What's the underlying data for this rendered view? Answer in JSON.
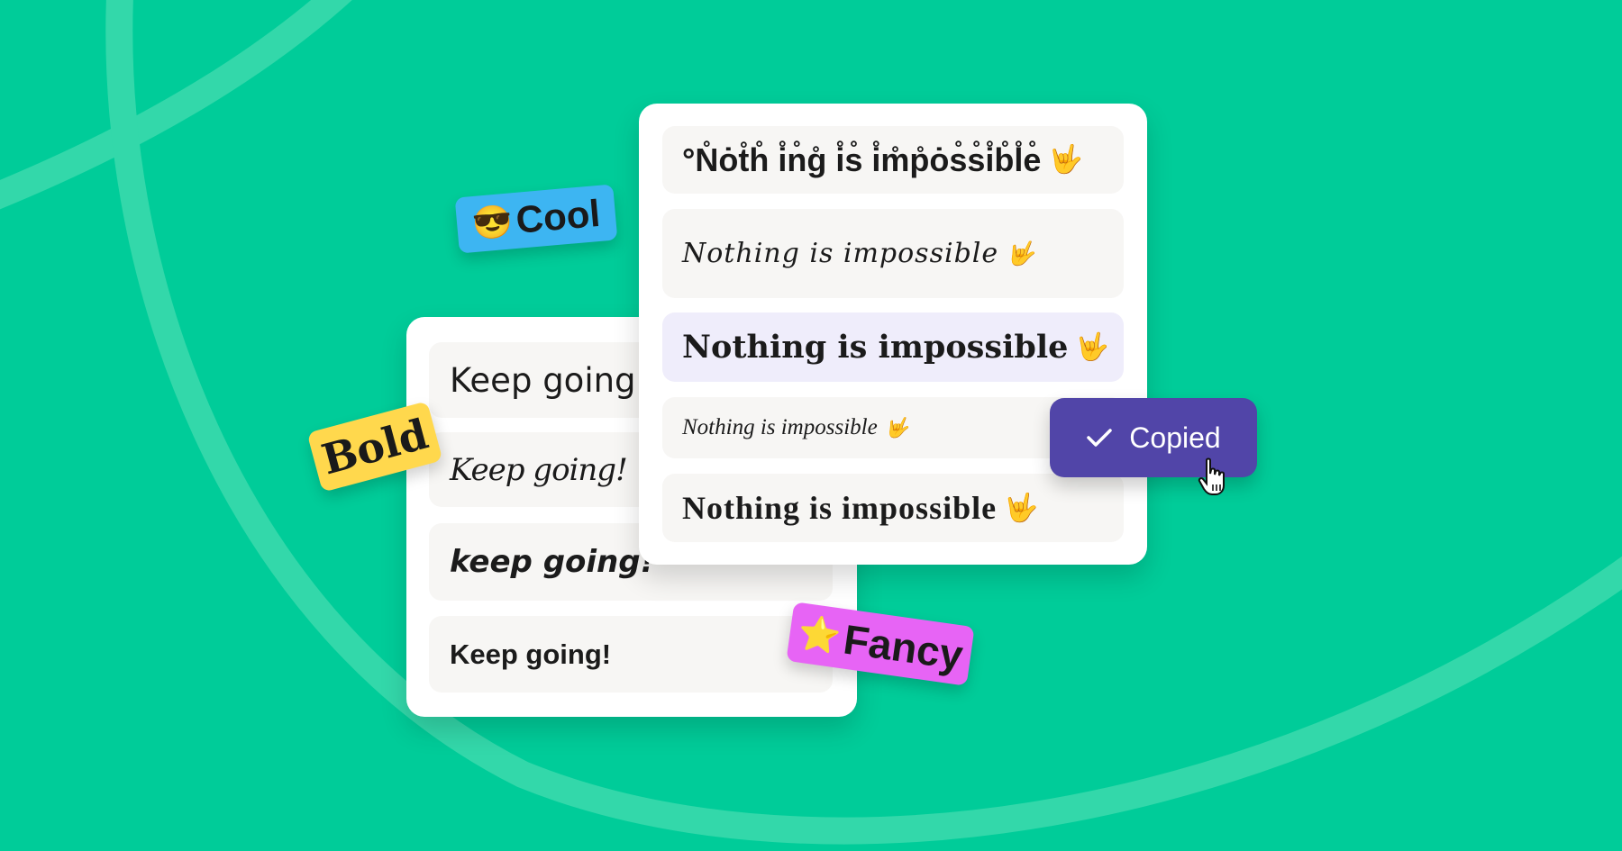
{
  "theme": {
    "background": "#00CC99",
    "arc_color": "#33D8AA",
    "card_background": "#FFFFFF",
    "row_background": "#F7F6F4",
    "selected_row_background": "#EFEDFB",
    "copied_button_color": "#5145A8"
  },
  "left_card": {
    "rows": [
      {
        "text": "Keep going!",
        "style": "rounded-sans"
      },
      {
        "text": "Keep going!",
        "style": "brush-script"
      },
      {
        "text": "keep going!",
        "style": "bold-brush"
      },
      {
        "text": "Keep going!",
        "style": "bold-sans"
      }
    ]
  },
  "right_card": {
    "rows": [
      {
        "text": "°N̊ȯt̊h̊ i̊n̊g̊ i̊s̊ i̊m̊p̊ȯs̊s̊i̊b̊l̊e̊",
        "plain": "Nothing is impossible",
        "emoji": "🤟",
        "style": "ring-diacritics"
      },
      {
        "text": "Nothing is impossible",
        "emoji": "🤟",
        "style": "handwriting"
      },
      {
        "text": "Nothing is impossible",
        "emoji": "🤟",
        "style": "bold-slab",
        "selected": true
      },
      {
        "text": "Nothing is impossible",
        "emoji": "🤟",
        "style": "elegant-script"
      },
      {
        "text": "Nothing is impossible",
        "emoji": "🤟",
        "style": "didone-bold"
      }
    ]
  },
  "copied_button": {
    "label": "Copied",
    "icon": "check-icon"
  },
  "stickers": {
    "cool": {
      "label": "Cool",
      "emoji": "😎",
      "color": "#3DB5F2"
    },
    "bold": {
      "label": "Bold",
      "color": "#FFD84D"
    },
    "fancy": {
      "label": "Fancy",
      "emoji": "⭐",
      "color": "#E764F5"
    }
  },
  "cursor": {
    "icon": "hand-pointer-icon"
  }
}
